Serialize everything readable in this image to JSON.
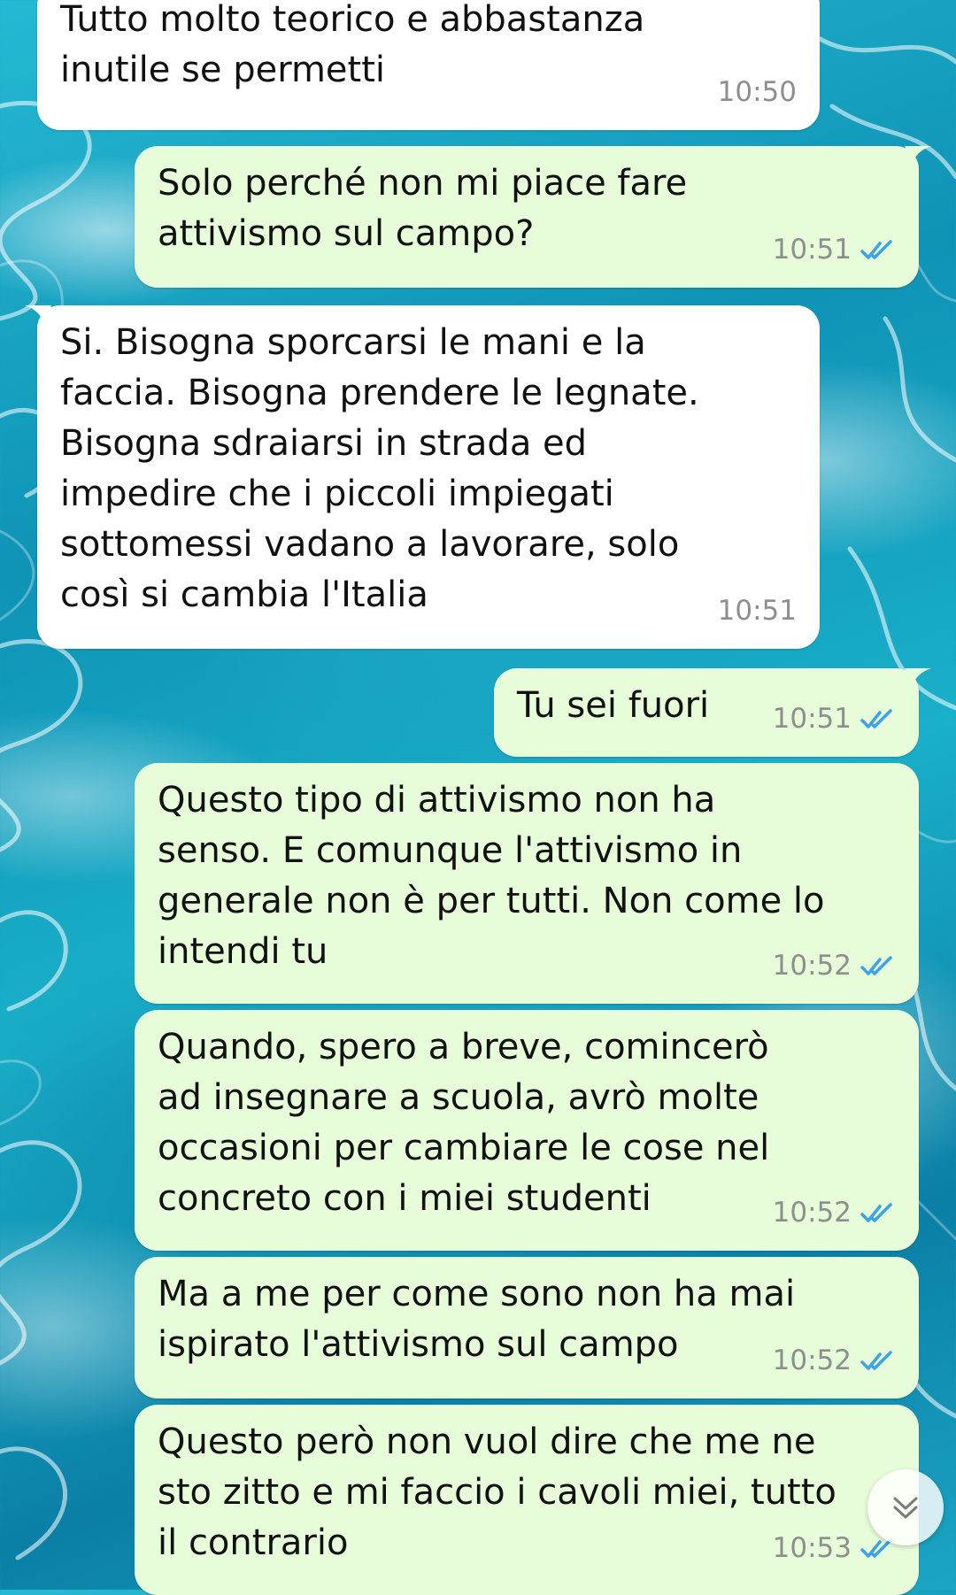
{
  "chat": {
    "messages": [
      {
        "direction": "in",
        "text": "Tutto molto teorico e abbastanza\ninutile se permetti",
        "time": "10:50"
      },
      {
        "direction": "out",
        "text": "Solo perché non mi piace fare\nattivismo sul campo?",
        "time": "10:51",
        "status": "read"
      },
      {
        "direction": "in",
        "text": "Si. Bisogna sporcarsi le mani e la\nfaccia. Bisogna prendere le legnate.\nBisogna sdraiarsi in strada ed\nimpedire che i piccoli impiegati\nsottomessi vadano a lavorare, solo\ncosì si cambia l'Italia",
        "time": "10:51"
      },
      {
        "direction": "out",
        "text": "Tu sei fuori",
        "time": "10:51",
        "status": "read"
      },
      {
        "direction": "out",
        "text": "Questo tipo di attivismo non ha\nsenso. E comunque l'attivismo in\ngenerale non è per tutti. Non come lo\nintendi tu",
        "time": "10:52",
        "status": "read"
      },
      {
        "direction": "out",
        "text": "Quando, spero a breve, comincerò\nad insegnare a scuola, avrò molte\noccasioni per cambiare le cose nel\nconcreto con i miei studenti",
        "time": "10:52",
        "status": "read"
      },
      {
        "direction": "out",
        "text": "Ma a me per come sono non ha mai\nispirato l'attivismo sul campo",
        "time": "10:52",
        "status": "read"
      },
      {
        "direction": "out",
        "text": "Questo però non vuol dire che me ne\nsto zitto e mi faccio i cavoli miei, tutto\nil contrario",
        "time": "10:53",
        "status": "read"
      }
    ]
  },
  "colors": {
    "incoming_bubble": "#ffffff",
    "outgoing_bubble": "#e7fcd8",
    "read_ticks": "#3ba3e6",
    "timestamp": "#8e8e8e",
    "wallpaper": "#1aa7c4"
  },
  "icons": {
    "read_receipt": "double-check-icon",
    "scroll_down": "chevron-double-down-icon"
  }
}
